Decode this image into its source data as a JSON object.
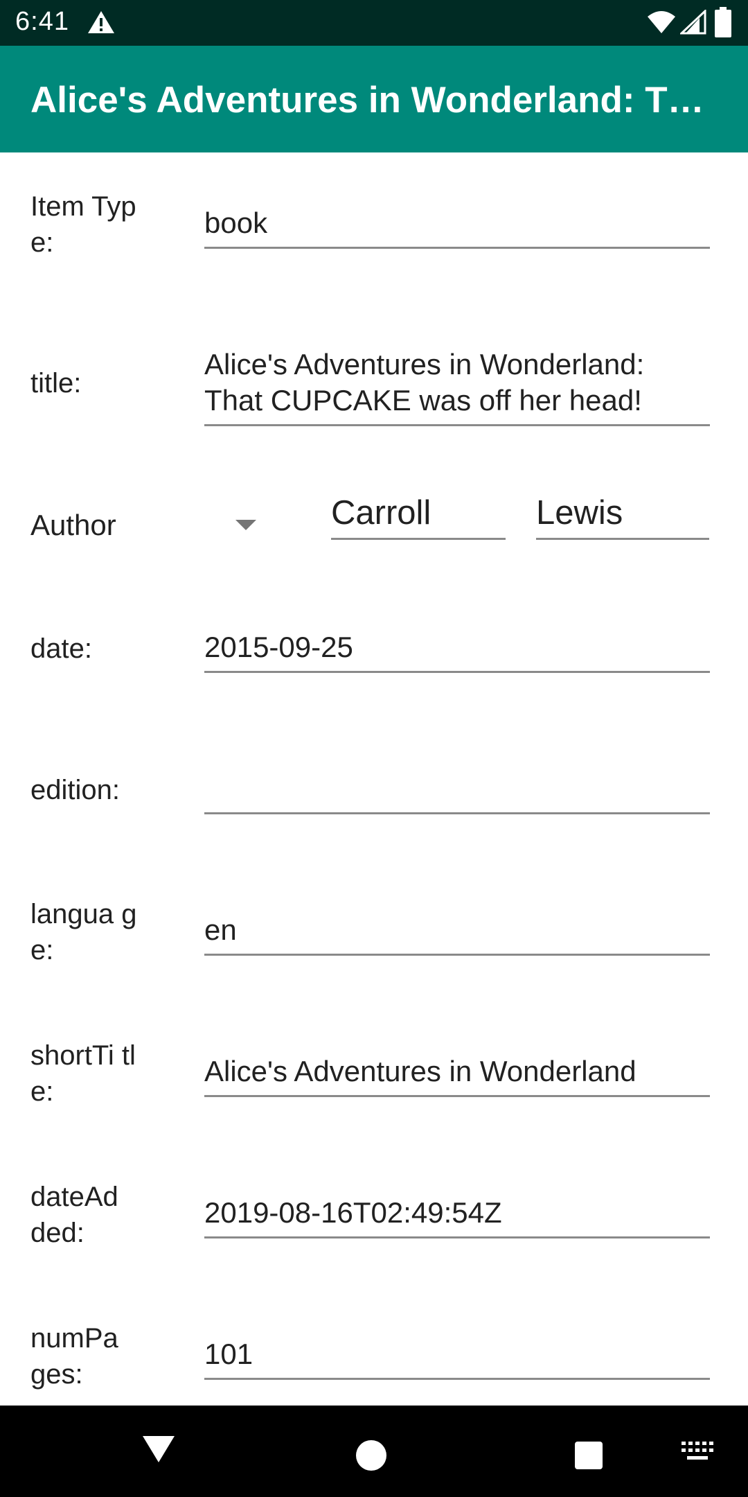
{
  "status_bar": {
    "time": "6:41"
  },
  "app_bar": {
    "title": "Alice's Adventures in Wonderland: That CUPCAKE was off her head!"
  },
  "fields": {
    "item_type": {
      "label": "Item Type:",
      "value": "book"
    },
    "title": {
      "label": "title:",
      "value": "Alice's Adventures in Wonderland:\nThat CUPCAKE was off her head!"
    },
    "author": {
      "label": "Author",
      "last_name": "Carroll",
      "first_name": "Lewis"
    },
    "date": {
      "label": "date:",
      "value": "2015-09-25"
    },
    "edition": {
      "label": "edition:",
      "value": ""
    },
    "language": {
      "label": "langua ge:",
      "value": "en"
    },
    "short_title": {
      "label": "shortTi tle:",
      "value": "Alice's Adventures in Wonderland"
    },
    "date_added": {
      "label": "dateAd ded:",
      "value": "2019-08-16T02:49:54Z"
    },
    "num_pages": {
      "label": "numPa ges:",
      "value": "101"
    }
  },
  "colors": {
    "status_bar": "#002b24",
    "app_bar": "#00897b",
    "nav_bar": "#000000"
  },
  "icons": [
    "warning-icon",
    "wifi-icon",
    "signal-icon",
    "battery-icon",
    "dropdown-caret-icon",
    "back-icon",
    "home-icon",
    "recents-icon",
    "keyboard-icon"
  ]
}
